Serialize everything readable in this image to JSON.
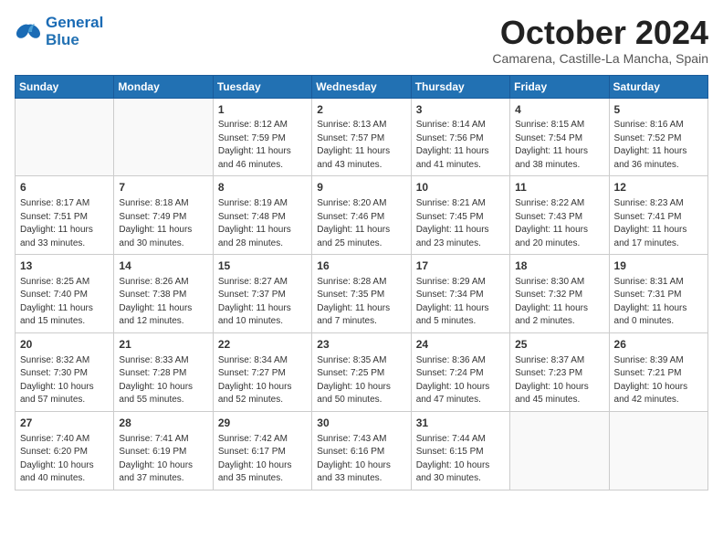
{
  "header": {
    "logo_line1": "General",
    "logo_line2": "Blue",
    "month": "October 2024",
    "location": "Camarena, Castille-La Mancha, Spain"
  },
  "weekdays": [
    "Sunday",
    "Monday",
    "Tuesday",
    "Wednesday",
    "Thursday",
    "Friday",
    "Saturday"
  ],
  "weeks": [
    [
      {
        "day": "",
        "info": ""
      },
      {
        "day": "",
        "info": ""
      },
      {
        "day": "1",
        "info": "Sunrise: 8:12 AM\nSunset: 7:59 PM\nDaylight: 11 hours\nand 46 minutes."
      },
      {
        "day": "2",
        "info": "Sunrise: 8:13 AM\nSunset: 7:57 PM\nDaylight: 11 hours\nand 43 minutes."
      },
      {
        "day": "3",
        "info": "Sunrise: 8:14 AM\nSunset: 7:56 PM\nDaylight: 11 hours\nand 41 minutes."
      },
      {
        "day": "4",
        "info": "Sunrise: 8:15 AM\nSunset: 7:54 PM\nDaylight: 11 hours\nand 38 minutes."
      },
      {
        "day": "5",
        "info": "Sunrise: 8:16 AM\nSunset: 7:52 PM\nDaylight: 11 hours\nand 36 minutes."
      }
    ],
    [
      {
        "day": "6",
        "info": "Sunrise: 8:17 AM\nSunset: 7:51 PM\nDaylight: 11 hours\nand 33 minutes."
      },
      {
        "day": "7",
        "info": "Sunrise: 8:18 AM\nSunset: 7:49 PM\nDaylight: 11 hours\nand 30 minutes."
      },
      {
        "day": "8",
        "info": "Sunrise: 8:19 AM\nSunset: 7:48 PM\nDaylight: 11 hours\nand 28 minutes."
      },
      {
        "day": "9",
        "info": "Sunrise: 8:20 AM\nSunset: 7:46 PM\nDaylight: 11 hours\nand 25 minutes."
      },
      {
        "day": "10",
        "info": "Sunrise: 8:21 AM\nSunset: 7:45 PM\nDaylight: 11 hours\nand 23 minutes."
      },
      {
        "day": "11",
        "info": "Sunrise: 8:22 AM\nSunset: 7:43 PM\nDaylight: 11 hours\nand 20 minutes."
      },
      {
        "day": "12",
        "info": "Sunrise: 8:23 AM\nSunset: 7:41 PM\nDaylight: 11 hours\nand 17 minutes."
      }
    ],
    [
      {
        "day": "13",
        "info": "Sunrise: 8:25 AM\nSunset: 7:40 PM\nDaylight: 11 hours\nand 15 minutes."
      },
      {
        "day": "14",
        "info": "Sunrise: 8:26 AM\nSunset: 7:38 PM\nDaylight: 11 hours\nand 12 minutes."
      },
      {
        "day": "15",
        "info": "Sunrise: 8:27 AM\nSunset: 7:37 PM\nDaylight: 11 hours\nand 10 minutes."
      },
      {
        "day": "16",
        "info": "Sunrise: 8:28 AM\nSunset: 7:35 PM\nDaylight: 11 hours\nand 7 minutes."
      },
      {
        "day": "17",
        "info": "Sunrise: 8:29 AM\nSunset: 7:34 PM\nDaylight: 11 hours\nand 5 minutes."
      },
      {
        "day": "18",
        "info": "Sunrise: 8:30 AM\nSunset: 7:32 PM\nDaylight: 11 hours\nand 2 minutes."
      },
      {
        "day": "19",
        "info": "Sunrise: 8:31 AM\nSunset: 7:31 PM\nDaylight: 11 hours\nand 0 minutes."
      }
    ],
    [
      {
        "day": "20",
        "info": "Sunrise: 8:32 AM\nSunset: 7:30 PM\nDaylight: 10 hours\nand 57 minutes."
      },
      {
        "day": "21",
        "info": "Sunrise: 8:33 AM\nSunset: 7:28 PM\nDaylight: 10 hours\nand 55 minutes."
      },
      {
        "day": "22",
        "info": "Sunrise: 8:34 AM\nSunset: 7:27 PM\nDaylight: 10 hours\nand 52 minutes."
      },
      {
        "day": "23",
        "info": "Sunrise: 8:35 AM\nSunset: 7:25 PM\nDaylight: 10 hours\nand 50 minutes."
      },
      {
        "day": "24",
        "info": "Sunrise: 8:36 AM\nSunset: 7:24 PM\nDaylight: 10 hours\nand 47 minutes."
      },
      {
        "day": "25",
        "info": "Sunrise: 8:37 AM\nSunset: 7:23 PM\nDaylight: 10 hours\nand 45 minutes."
      },
      {
        "day": "26",
        "info": "Sunrise: 8:39 AM\nSunset: 7:21 PM\nDaylight: 10 hours\nand 42 minutes."
      }
    ],
    [
      {
        "day": "27",
        "info": "Sunrise: 7:40 AM\nSunset: 6:20 PM\nDaylight: 10 hours\nand 40 minutes."
      },
      {
        "day": "28",
        "info": "Sunrise: 7:41 AM\nSunset: 6:19 PM\nDaylight: 10 hours\nand 37 minutes."
      },
      {
        "day": "29",
        "info": "Sunrise: 7:42 AM\nSunset: 6:17 PM\nDaylight: 10 hours\nand 35 minutes."
      },
      {
        "day": "30",
        "info": "Sunrise: 7:43 AM\nSunset: 6:16 PM\nDaylight: 10 hours\nand 33 minutes."
      },
      {
        "day": "31",
        "info": "Sunrise: 7:44 AM\nSunset: 6:15 PM\nDaylight: 10 hours\nand 30 minutes."
      },
      {
        "day": "",
        "info": ""
      },
      {
        "day": "",
        "info": ""
      }
    ]
  ]
}
